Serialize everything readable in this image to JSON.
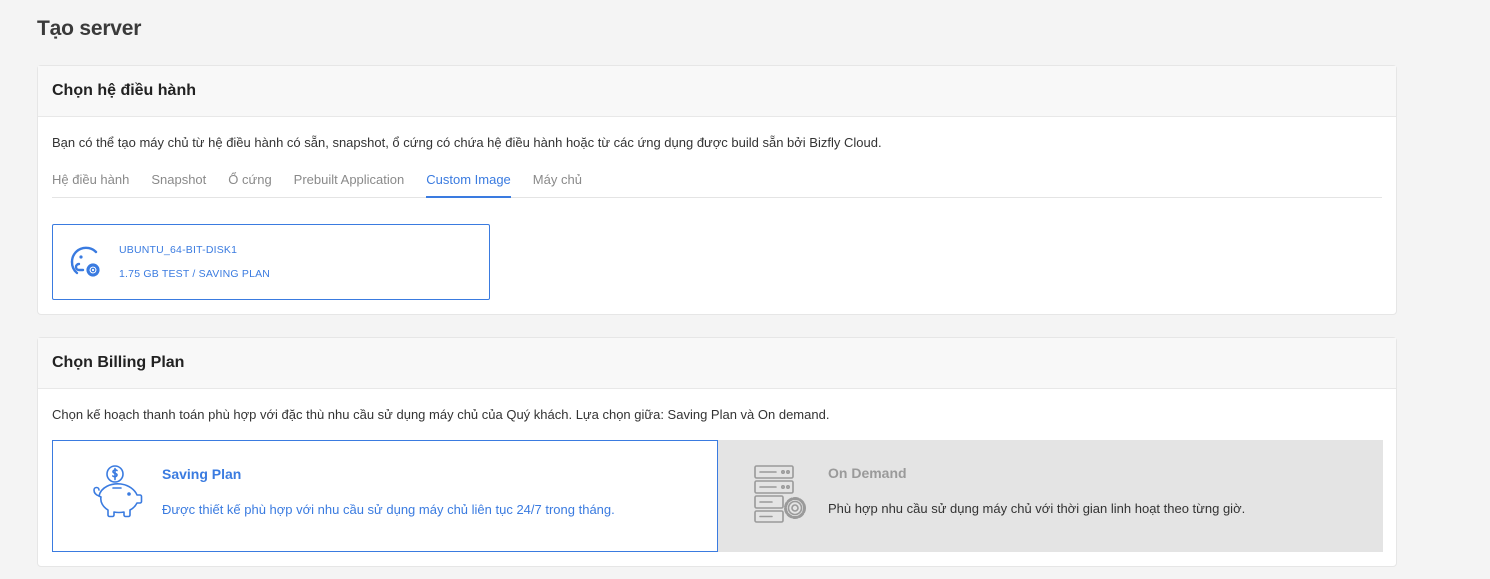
{
  "page": {
    "title": "Tạo server"
  },
  "os_section": {
    "title": "Chọn hệ điều hành",
    "description": "Bạn có thể tạo máy chủ từ hệ điều hành có sẵn, snapshot, ổ cứng có chứa hệ điều hành hoặc từ các ứng dụng được build sẵn bởi Bizfly Cloud.",
    "tabs": [
      {
        "label": "Hệ điều hành"
      },
      {
        "label": "Snapshot"
      },
      {
        "label": "Ổ cứng"
      },
      {
        "label": "Prebuilt Application"
      },
      {
        "label": "Custom Image",
        "active": true
      },
      {
        "label": "Máy chủ"
      }
    ],
    "selected_image": {
      "name": "UBUNTU_64-BIT-DISK1",
      "meta": "1.75 GB TEST / SAVING PLAN",
      "icon": "disk-gear-icon"
    }
  },
  "billing_section": {
    "title": "Chọn Billing Plan",
    "description": "Chọn kế hoạch thanh toán phù hợp với đặc thù nhu cầu sử dụng máy chủ của Quý khách. Lựa chọn giữa: Saving Plan và On demand.",
    "plans": {
      "saving": {
        "title": "Saving Plan",
        "description": "Được thiết kế phù hợp với nhu cầu sử dụng máy chủ liên tục 24/7 trong tháng.",
        "icon": "piggy-bank-icon",
        "selected": true
      },
      "ondemand": {
        "title": "On Demand",
        "description": "Phù hợp nhu cầu sử dụng máy chủ với thời gian linh hoạt theo từng giờ.",
        "icon": "server-gear-icon",
        "selected": false
      }
    }
  },
  "colors": {
    "accent": "#3a7be0",
    "muted_text": "#8a8a8a",
    "disabled_bg": "#e4e4e4"
  }
}
